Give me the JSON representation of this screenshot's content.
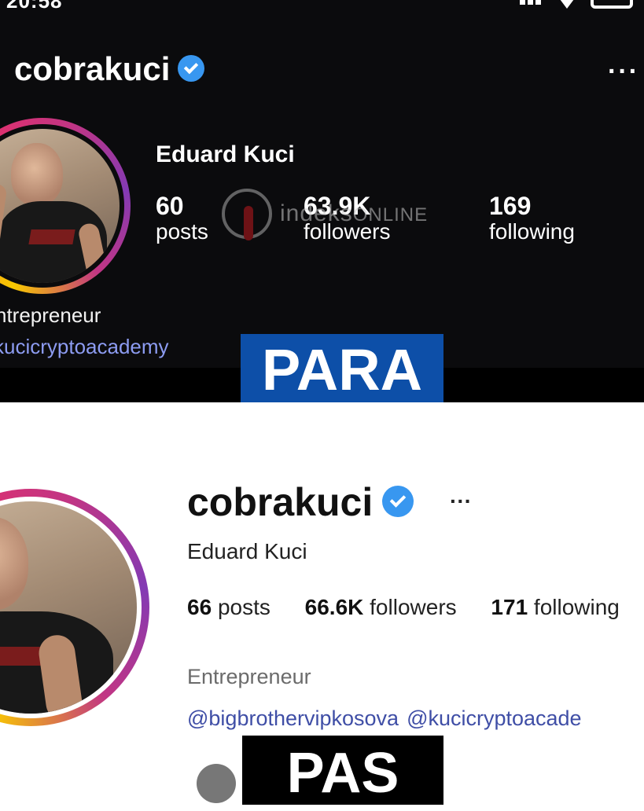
{
  "top": {
    "status_time": "20:58",
    "username": "cobrakuci",
    "more_label": "···",
    "full_name": "Eduard Kuci",
    "stats": [
      {
        "value": "60",
        "label": "posts"
      },
      {
        "value": "63.9K",
        "label": "followers"
      },
      {
        "value": "169",
        "label": "following"
      }
    ],
    "bio": "ntrepreneur",
    "link": "kucicryptoacademy",
    "label": "PARA"
  },
  "watermark": {
    "brand": "indeks",
    "suffix": "ONLINE"
  },
  "bottom": {
    "username": "cobrakuci",
    "more_label": "···",
    "full_name": "Eduard Kuci",
    "stats": [
      {
        "value": "66",
        "label": "posts"
      },
      {
        "value": "66.6K",
        "label": "followers"
      },
      {
        "value": "171",
        "label": "following"
      }
    ],
    "bio": "Entrepreneur",
    "links": [
      "@bigbrothervipkosova",
      "@kucicryptoacade"
    ],
    "label": "PAS"
  },
  "colors": {
    "dark_bg": "#0b0b0d",
    "verified_blue": "#3897f0",
    "para_label_bg": "#0d4fa8",
    "pas_label_bg": "#000000",
    "link_light": "#3f4ea6",
    "link_dark": "#8d9cf2"
  }
}
